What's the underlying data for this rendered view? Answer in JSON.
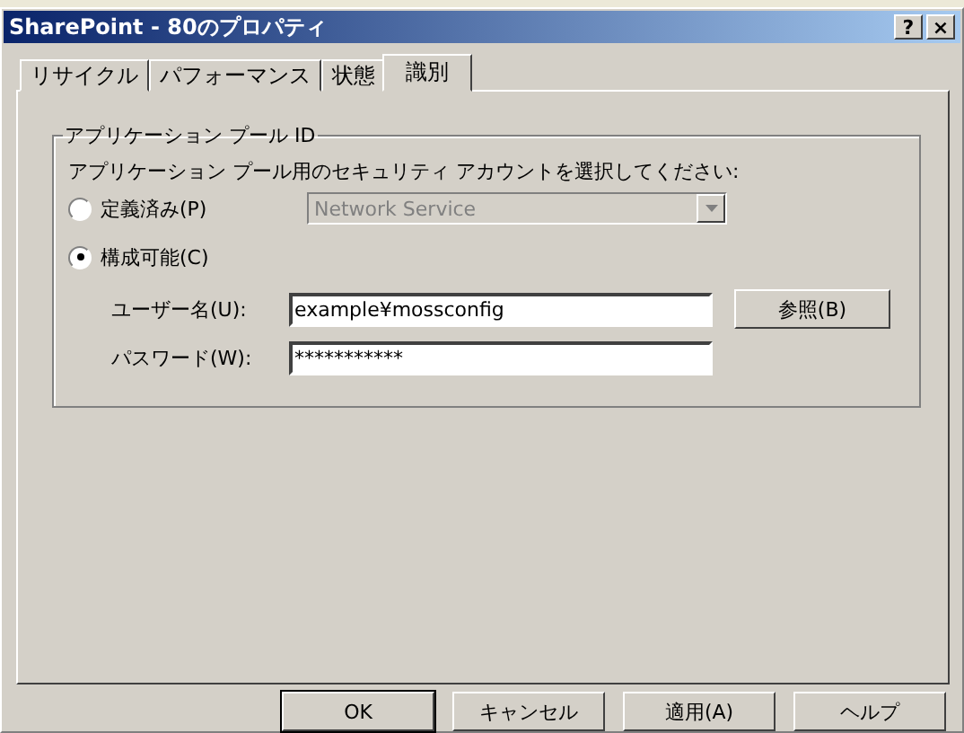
{
  "window": {
    "title": "SharePoint - 80のプロパティ",
    "help_button": "?",
    "close_button": "×"
  },
  "tabs": [
    {
      "label": "リサイクル",
      "selected": false
    },
    {
      "label": "パフォーマンス",
      "selected": false
    },
    {
      "label": "状態",
      "selected": false
    },
    {
      "label": "識別",
      "selected": true
    }
  ],
  "group": {
    "title": "アプリケーション プール ID",
    "description": "アプリケーション プール用のセキュリティ アカウントを選択してください:",
    "options": [
      {
        "label": "定義済み(P)",
        "selected": false
      },
      {
        "label": "構成可能(C)",
        "selected": true
      }
    ],
    "predefined": {
      "value": "Network Service",
      "disabled": true
    },
    "username": {
      "label": "ユーザー名(U):",
      "value": "example¥mossconfig"
    },
    "password": {
      "label": "パスワード(W):",
      "value": "***********"
    },
    "browse_button": "参照(B)"
  },
  "buttons": [
    {
      "label": "OK",
      "default": true
    },
    {
      "label": "キャンセル",
      "default": false
    },
    {
      "label": "適用(A)",
      "default": false
    },
    {
      "label": "ヘルプ",
      "default": false
    }
  ]
}
